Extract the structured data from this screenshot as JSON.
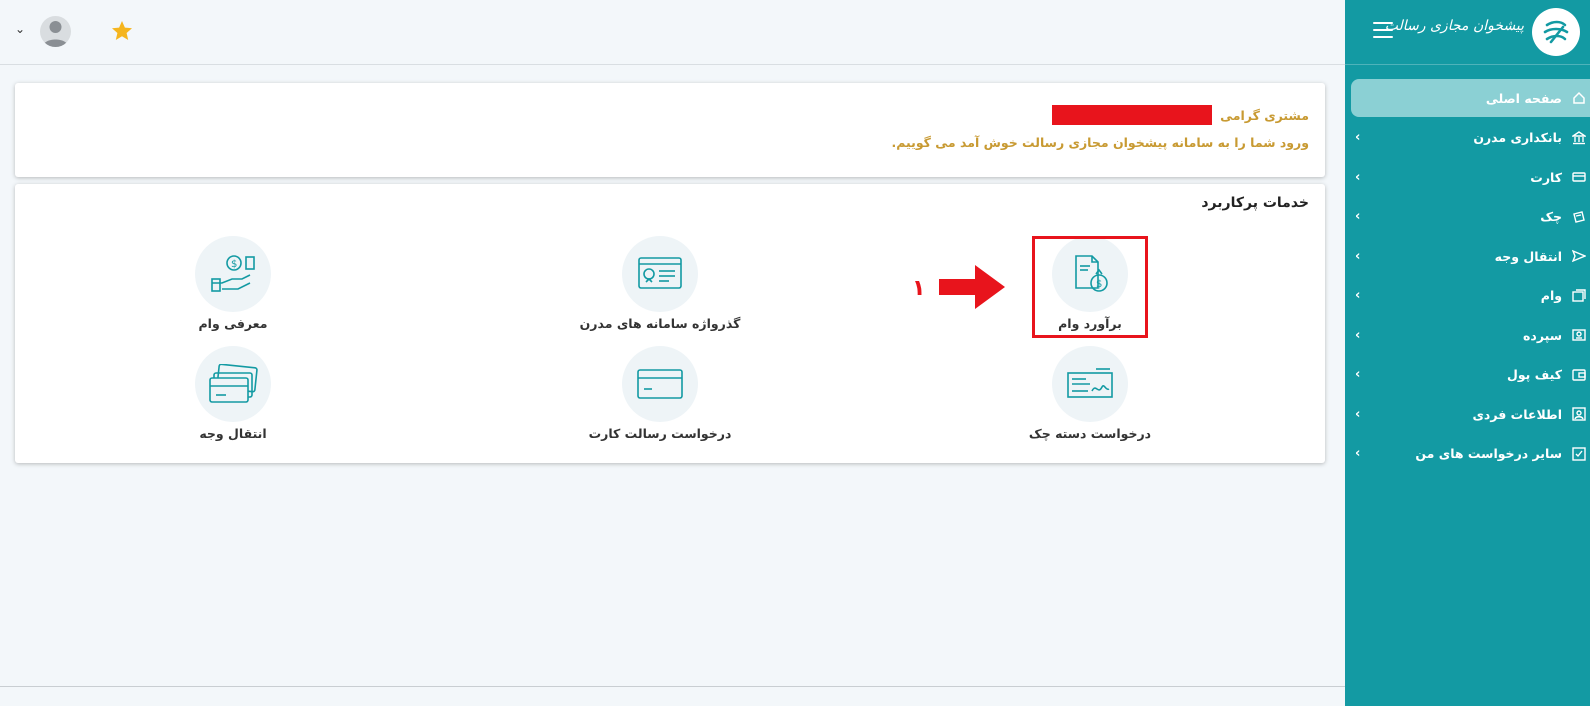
{
  "sidebar": {
    "logo_text": "پیشخوان مجازی رسالت",
    "items": [
      {
        "label": "صفحه اصلی",
        "icon": "home-icon",
        "active": true
      },
      {
        "label": "بانکداری مدرن",
        "icon": "bank-icon"
      },
      {
        "label": "کارت",
        "icon": "card-icon"
      },
      {
        "label": "چک",
        "icon": "cheque-icon"
      },
      {
        "label": "انتقال وجه",
        "icon": "send-icon"
      },
      {
        "label": "وام",
        "icon": "loan-icon"
      },
      {
        "label": "سپرده",
        "icon": "deposit-icon"
      },
      {
        "label": "کیف پول",
        "icon": "wallet-icon"
      },
      {
        "label": "اطلاعات فردی",
        "icon": "profile-icon"
      },
      {
        "label": "سایر درخواست های من",
        "icon": "checklist-icon"
      }
    ],
    "chevron": "‹"
  },
  "topbar": {
    "dropdown_chevron": "⌄"
  },
  "welcome": {
    "greeting": "مشتری گرامی",
    "message": "ورود شما را به سامانه پیشخوان مجازی رسالت خوش آمد می گوییم."
  },
  "services": {
    "title": "خدمات پرکاربرد",
    "items": [
      {
        "label": "برآورد وام",
        "icon": "loan-estimate-icon"
      },
      {
        "label": "گذرواژه سامانه های مدرن",
        "icon": "modern-password-icon"
      },
      {
        "label": "معرفی وام",
        "icon": "loan-intro-icon"
      },
      {
        "label": "درخواست دسته چک",
        "icon": "chequebook-icon"
      },
      {
        "label": "درخواست رسالت کارت",
        "icon": "card-request-icon"
      },
      {
        "label": "انتقال وجه",
        "icon": "money-transfer-icon"
      }
    ]
  },
  "annotation": {
    "step_number": "۱"
  },
  "colors": {
    "brand_teal": "#139aa3",
    "accent_gold": "#c89a32",
    "highlight_red": "#e8141c"
  }
}
